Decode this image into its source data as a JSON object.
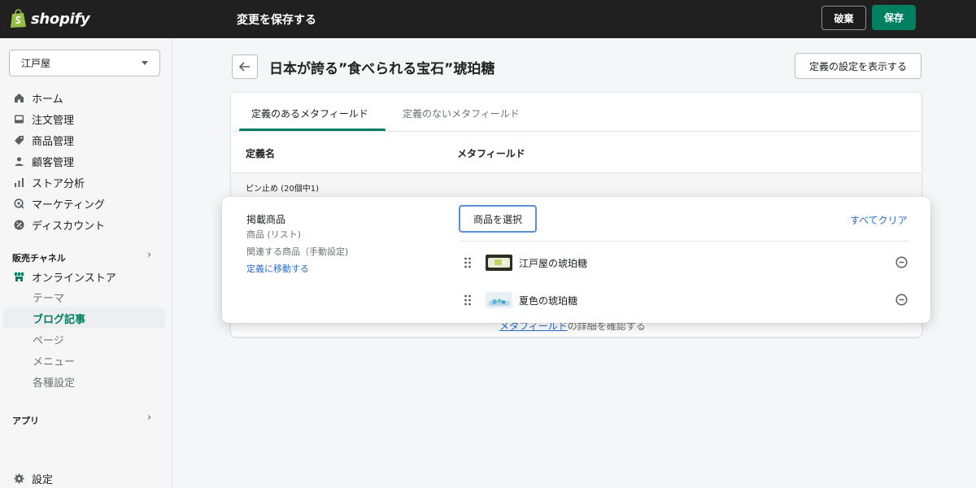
{
  "topbar": {
    "logo_text": "shopify",
    "message": "変更を保存する",
    "discard_label": "破棄",
    "save_label": "保存"
  },
  "colors": {
    "primary": "#008060",
    "link": "#2c6ecb",
    "topbar": "#202020"
  },
  "sidebar": {
    "store_name": "江戸屋",
    "items": [
      {
        "label": "ホーム",
        "icon": "home-icon"
      },
      {
        "label": "注文管理",
        "icon": "inbox-icon"
      },
      {
        "label": "商品管理",
        "icon": "tag-icon"
      },
      {
        "label": "顧客管理",
        "icon": "person-icon"
      },
      {
        "label": "ストア分析",
        "icon": "bar-chart-icon"
      },
      {
        "label": "マーケティング",
        "icon": "target-icon"
      },
      {
        "label": "ディスカウント",
        "icon": "discount-icon"
      }
    ],
    "sales_channels_label": "販売チャネル",
    "online_store_label": "オンラインストア",
    "sub_items": [
      "テーマ",
      "ブログ記事",
      "ページ",
      "メニュー",
      "各種設定"
    ],
    "active_sub_index": 1,
    "apps_label": "アプリ",
    "settings_label": "設定"
  },
  "page": {
    "title": "日本が誇る”食べられる宝石”琥珀糖",
    "settings_button": "定義の設定を表示する"
  },
  "tabs": [
    {
      "label": "定義のあるメタフィールド",
      "active": true
    },
    {
      "label": "定義のないメタフィールド",
      "active": false
    }
  ],
  "table": {
    "col_name": "定義名",
    "col_metafield": "メタフィールド",
    "pinned_label": "ピン止め (20個中1)",
    "detail_link_text": "メタフィールド",
    "detail_suffix": "の詳細を確認する"
  },
  "metafield": {
    "title": "掲載商品",
    "type": "商品 (リスト)",
    "description": "関連する商品（手動設定)",
    "goto_link": "定義に移動する",
    "select_button": "商品を選択",
    "clear_all": "すべてクリア",
    "products": [
      {
        "name": "江戸屋の琥珀糖"
      },
      {
        "name": "夏色の琥珀糖"
      }
    ]
  }
}
